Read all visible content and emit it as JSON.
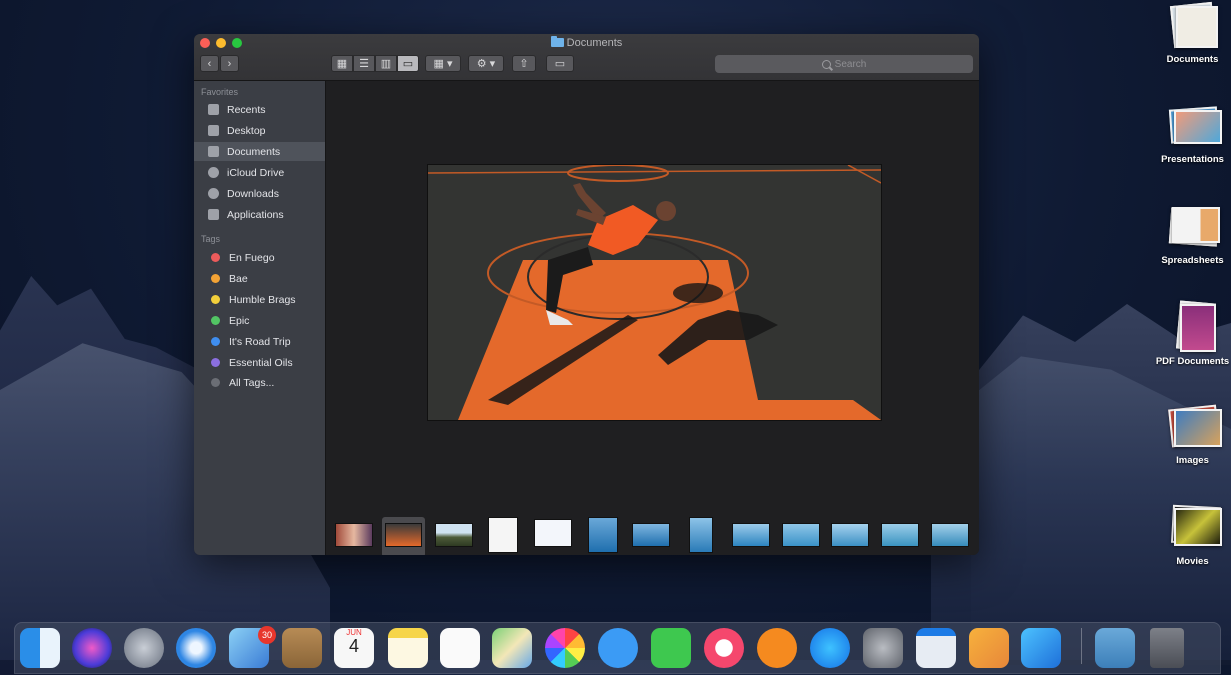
{
  "window": {
    "title": "Documents",
    "search_placeholder": "Search"
  },
  "sidebar": {
    "favorites_header": "Favorites",
    "favorites": [
      {
        "label": "Recents",
        "icon": "recents-icon"
      },
      {
        "label": "Desktop",
        "icon": "desktop-icon"
      },
      {
        "label": "Documents",
        "icon": "documents-icon",
        "selected": true
      },
      {
        "label": "iCloud Drive",
        "icon": "icloud-icon"
      },
      {
        "label": "Downloads",
        "icon": "downloads-icon"
      },
      {
        "label": "Applications",
        "icon": "applications-icon"
      }
    ],
    "tags_header": "Tags",
    "tags": [
      {
        "label": "En Fuego",
        "color": "#ec5b5b"
      },
      {
        "label": "Bae",
        "color": "#f3a335"
      },
      {
        "label": "Humble Brags",
        "color": "#f2cf3b"
      },
      {
        "label": "Epic",
        "color": "#52c564"
      },
      {
        "label": "It's Road Trip",
        "color": "#3f8ef0"
      },
      {
        "label": "Essential Oils",
        "color": "#8b6fe0"
      },
      {
        "label": "All Tags...",
        "color": "#6b6e75"
      }
    ]
  },
  "desktop_stacks": [
    {
      "label": "Documents"
    },
    {
      "label": "Presentations"
    },
    {
      "label": "Spreadsheets"
    },
    {
      "label": "PDF Documents"
    },
    {
      "label": "Images"
    },
    {
      "label": "Movies"
    }
  ],
  "dock": {
    "mail_badge": "30",
    "calendar_month": "JUN",
    "calendar_day": "4"
  },
  "colors": {
    "court_orange": "#e4692b",
    "sidebar_bg": "#3b3e45"
  }
}
